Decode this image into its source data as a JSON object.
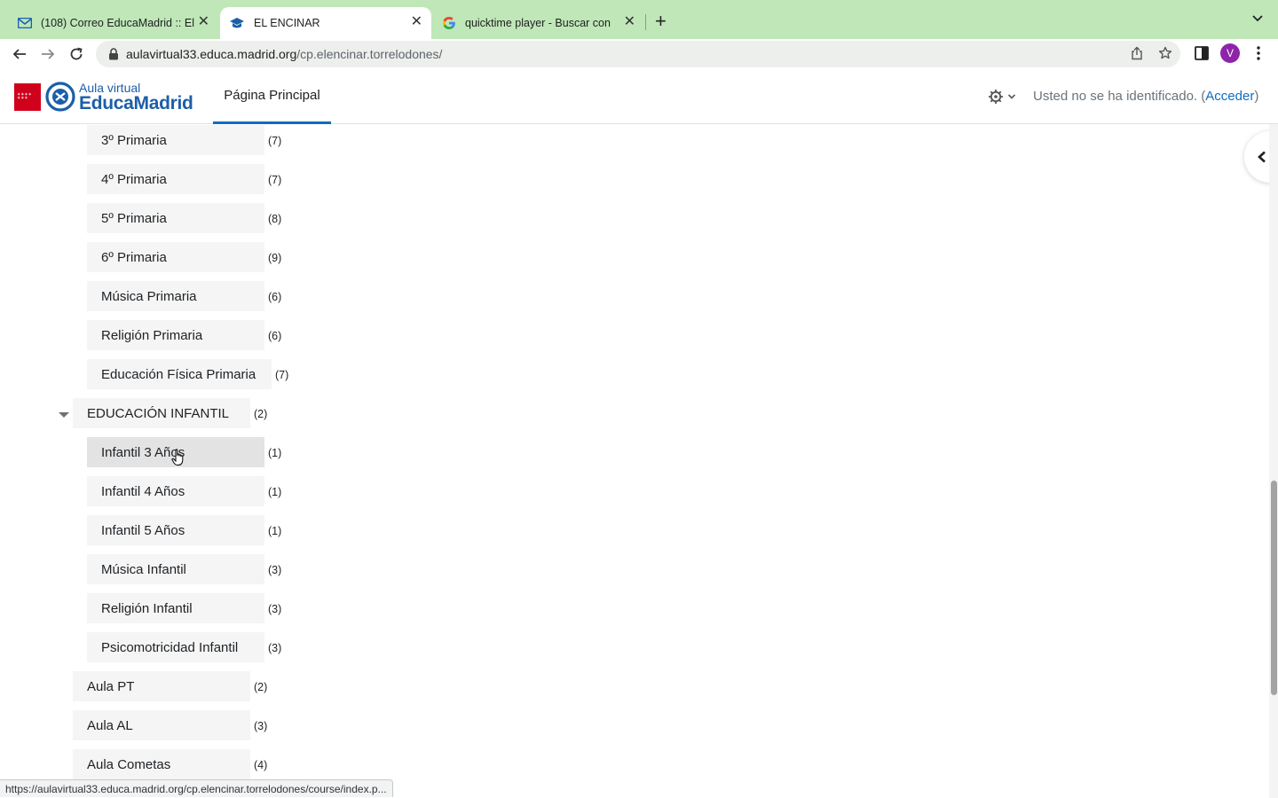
{
  "browser": {
    "tabs": [
      {
        "title": "(108) Correo EducaMadrid :: El",
        "icon": "mail-icon",
        "active": false
      },
      {
        "title": "EL ENCINAR",
        "icon": "graduation-cap-icon",
        "active": true
      },
      {
        "title": "quicktime player - Buscar con G",
        "icon": "google-icon",
        "active": false
      }
    ],
    "url_host": "aulavirtual33.educa.madrid.org",
    "url_path": "/cp.elencinar.torrelodones/",
    "profile_initial": "V",
    "status_url": "https://aulavirtual33.educa.madrid.org/cp.elencinar.torrelodones/course/index.p..."
  },
  "header": {
    "logo_line1": "Aula virtual",
    "logo_line2": "EducaMadrid",
    "nav_home": "Página Principal",
    "login_text": "Usted no se ha identificado. (",
    "login_link": "Acceder",
    "login_close": ")"
  },
  "categories": [
    {
      "name": "3º Primaria",
      "count": "(7)"
    },
    {
      "name": "4º Primaria",
      "count": "(7)"
    },
    {
      "name": "5º Primaria",
      "count": "(8)"
    },
    {
      "name": "6º Primaria",
      "count": "(9)"
    },
    {
      "name": "Música Primaria",
      "count": "(6)"
    },
    {
      "name": "Religión Primaria",
      "count": "(6)"
    },
    {
      "name": "Educación Física Primaria",
      "count": "(7)"
    },
    {
      "name": "EDUCACIÓN INFANTIL",
      "count": "(2)"
    },
    {
      "name": "Infantil 3 Años",
      "count": "(1)"
    },
    {
      "name": "Infantil 4 Años",
      "count": "(1)"
    },
    {
      "name": "Infantil 5 Años",
      "count": "(1)"
    },
    {
      "name": "Música Infantil",
      "count": "(3)"
    },
    {
      "name": "Religión Infantil",
      "count": "(3)"
    },
    {
      "name": "Psicomotricidad Infantil",
      "count": "(3)"
    },
    {
      "name": "Aula PT",
      "count": "(2)"
    },
    {
      "name": "Aula AL",
      "count": "(3)"
    },
    {
      "name": "Aula Cometas",
      "count": "(4)"
    }
  ],
  "colors": {
    "tabbar": "#bfe7b8",
    "link": "#0f6cbf",
    "brand_red": "#d0021b",
    "brand_blue": "#1b5fa8"
  }
}
